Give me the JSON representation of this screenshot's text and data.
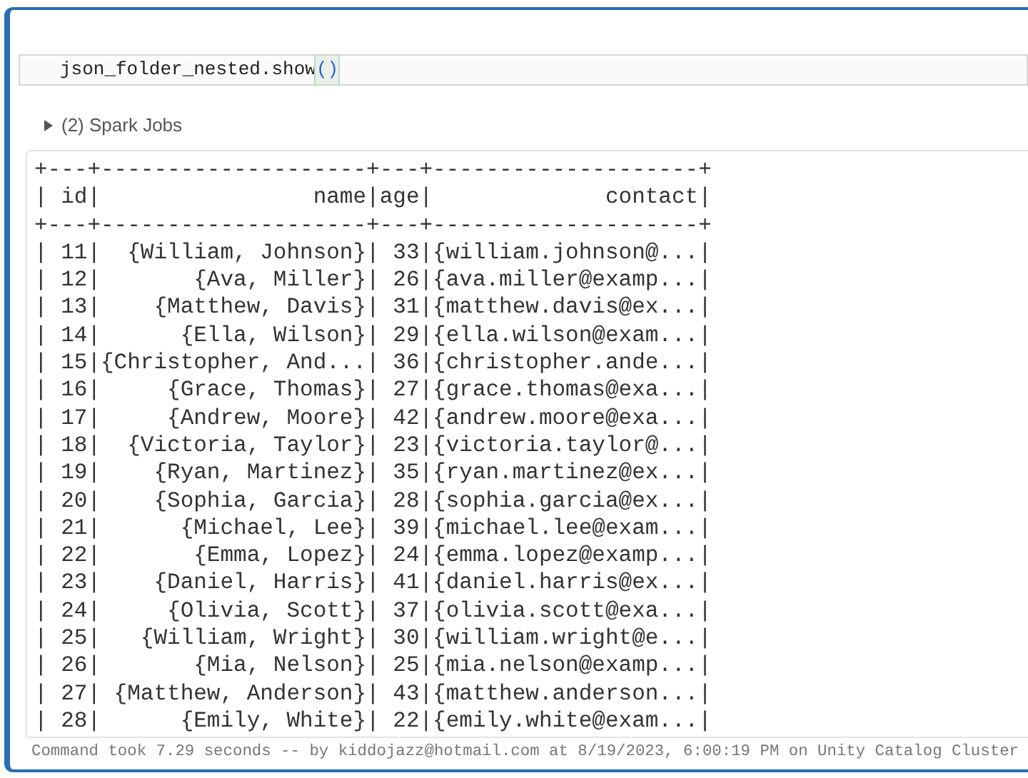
{
  "code_cell": {
    "tokens": [
      {
        "kind": "plain",
        "text": "json_folder_nested.show"
      },
      {
        "kind": "bracket",
        "text": "()"
      }
    ]
  },
  "spark_jobs": {
    "label": "(2) Spark Jobs",
    "expanded": false
  },
  "output_lines": [
    "+---+--------------------+---+--------------------+",
    "| id|                name|age|             contact|",
    "+---+--------------------+---+--------------------+",
    "| 11|  {William, Johnson}| 33|{william.johnson@...|",
    "| 12|       {Ava, Miller}| 26|{ava.miller@examp...|",
    "| 13|    {Matthew, Davis}| 31|{matthew.davis@ex...|",
    "| 14|      {Ella, Wilson}| 29|{ella.wilson@exam...|",
    "| 15|{Christopher, And...| 36|{christopher.ande...|",
    "| 16|     {Grace, Thomas}| 27|{grace.thomas@exa...|",
    "| 17|     {Andrew, Moore}| 42|{andrew.moore@exa...|",
    "| 18|  {Victoria, Taylor}| 23|{victoria.taylor@...|",
    "| 19|    {Ryan, Martinez}| 35|{ryan.martinez@ex...|",
    "| 20|    {Sophia, Garcia}| 28|{sophia.garcia@ex...|",
    "| 21|      {Michael, Lee}| 39|{michael.lee@exam...|",
    "| 22|       {Emma, Lopez}| 24|{emma.lopez@examp...|",
    "| 23|    {Daniel, Harris}| 41|{daniel.harris@ex...|",
    "| 24|     {Olivia, Scott}| 37|{olivia.scott@exa...|",
    "| 25|   {William, Wright}| 30|{william.wright@e...|",
    "| 26|       {Mia, Nelson}| 25|{mia.nelson@examp...|",
    "| 27| {Matthew, Anderson}| 43|{matthew.anderson...|",
    "| 28|      {Emily, White}| 22|{emily.white@exam...|"
  ],
  "status": "Command took 7.29 seconds -- by kiddojazz@hotmail.com at 8/19/2023, 6:00:19 PM on Unity Catalog Cluster"
}
